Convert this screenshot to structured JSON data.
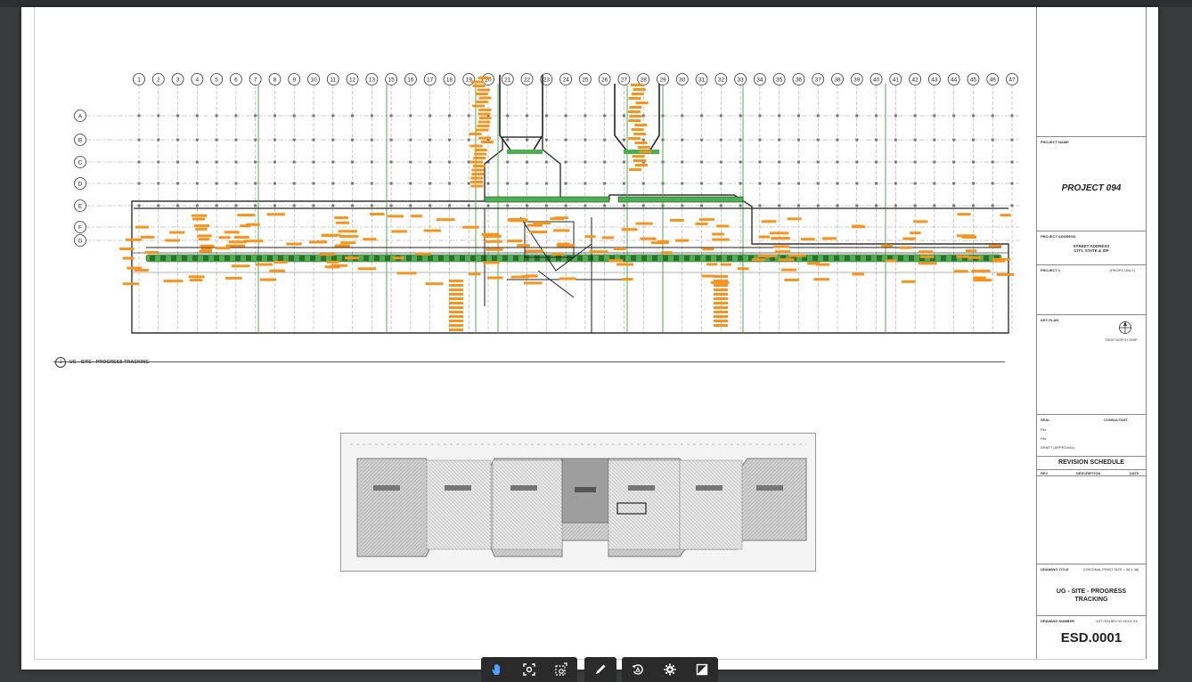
{
  "viewer": {
    "toolbar_groups": [
      {
        "tools": [
          {
            "name": "pan-hand-icon",
            "label": "pan"
          },
          {
            "name": "fit-view-icon",
            "label": "fit"
          },
          {
            "name": "screenshot-icon",
            "label": "capture"
          }
        ]
      },
      {
        "tools": [
          {
            "name": "pencil-icon",
            "label": "markup"
          }
        ]
      },
      {
        "tools": [
          {
            "name": "rotate-icon",
            "label": "rotate"
          },
          {
            "name": "gear-icon",
            "label": "settings"
          },
          {
            "name": "compare-icon",
            "label": "compare"
          }
        ]
      }
    ],
    "accent_color": "#f7941d",
    "highlight_color": "#4caf50"
  },
  "drawing": {
    "grid_columns": [
      "1",
      "2",
      "3",
      "4",
      "5",
      "6",
      "7",
      "8",
      "9",
      "10",
      "11",
      "12",
      "13",
      "15",
      "16",
      "17",
      "18",
      "19",
      "20",
      "21",
      "22",
      "23",
      "24",
      "25",
      "26",
      "27",
      "28",
      "29",
      "30",
      "31",
      "32",
      "33",
      "34",
      "35",
      "36",
      "37",
      "38",
      "39",
      "40",
      "41",
      "42",
      "43",
      "44",
      "45",
      "46",
      "47"
    ],
    "grid_rows": [
      "A",
      "B",
      "C",
      "D",
      "E",
      "F",
      "G"
    ],
    "caption_number": "1",
    "caption_text": "UG - SITE - PROGRESS TRACKING"
  },
  "title_block": {
    "project_name_label": "PROJECT NAME",
    "project_name": "PROJECT 094",
    "project_address_label": "PROJECT ADDRESS",
    "address_line1": "STREET ADDRESS",
    "address_line2": "CITY, STATE & ZIP",
    "project_number_label": "PROJECT #",
    "project_number": "(PROPS ONLY)",
    "key_plan_label": "KEY PLAN",
    "north_label": "TRUE NORTH SHIP",
    "seal_label": "SEAL",
    "consultant_label": "CONSULTANT",
    "seal_line1": "File",
    "seal_line2": "File",
    "draft_label": "DRAFT (APPROVAL)",
    "revision_schedule": "REVISION SCHEDULE",
    "rev_cols": [
      "REV",
      "DESCRIPTION",
      "DATE"
    ],
    "drawing_title_label": "DRAWING TITLE",
    "scale_note": "(ORIGINAL PRINT SIZE = 36 x 48)",
    "drawing_title": "UG - SITE - PROGRESS TRACKING",
    "drawing_number_label": "DRAWING NUMBER",
    "issued_note": "1ST ISSUED 00 XXXX XX",
    "sheet_number": "ESD.0001"
  }
}
